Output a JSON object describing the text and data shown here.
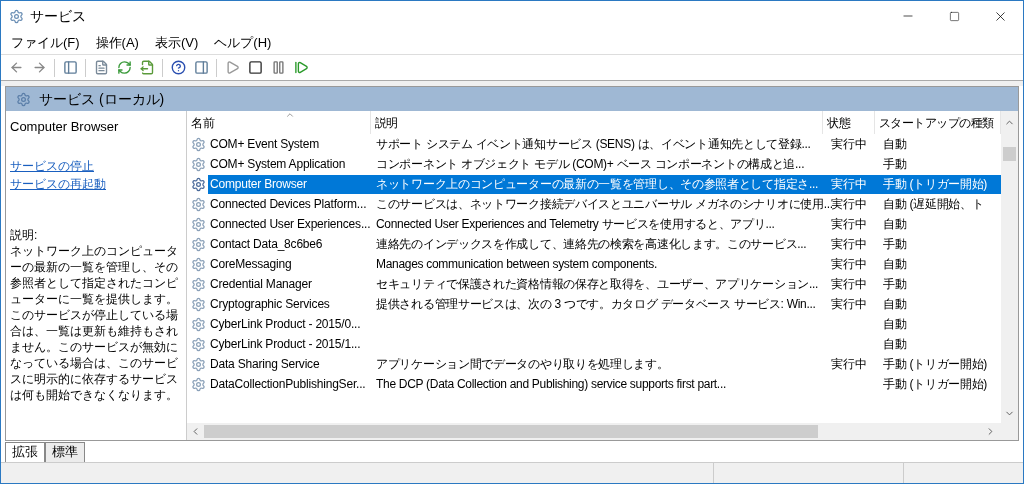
{
  "window": {
    "title": "サービス"
  },
  "menu": [
    "ファイル(F)",
    "操作(A)",
    "表示(V)",
    "ヘルプ(H)"
  ],
  "panel_header": "サービス (ローカル)",
  "detail": {
    "title": "Computer Browser",
    "links": [
      "サービスの停止",
      "サービスの再起動"
    ],
    "description_label": "説明:",
    "description": "ネットワーク上のコンピューターの最新の一覧を管理し、その参照者として指定されたコンピューターに一覧を提供します。このサービスが停止している場合は、一覧は更新も維持もされません。このサービスが無効になっている場合は、このサービスに明示的に依存するサービスは何も開始できなくなります。"
  },
  "table": {
    "columns": [
      "名前",
      "説明",
      "状態",
      "スタートアップの種類"
    ],
    "rows": [
      {
        "name": "COM+ Event System",
        "description": "サポート システム イベント通知サービス (SENS) は、イベント通知先として登録...",
        "status": "実行中",
        "startup": "自動",
        "selected": false
      },
      {
        "name": "COM+ System Application",
        "description": "コンポーネント オブジェクト モデル (COM)+ ベース コンポーネントの構成と追...",
        "status": "",
        "startup": "手動",
        "selected": false
      },
      {
        "name": "Computer Browser",
        "description": "ネットワーク上のコンピューターの最新の一覧を管理し、その参照者として指定さ...",
        "status": "実行中",
        "startup": "手動 (トリガー開始)",
        "selected": true
      },
      {
        "name": "Connected Devices Platform...",
        "description": "このサービスは、ネットワーク接続デバイスとユニバーサル メガネのシナリオに使用...",
        "status": "実行中",
        "startup": "自動 (遅延開始、ト",
        "selected": false
      },
      {
        "name": "Connected User Experiences...",
        "description": "Connected User Experiences and Telemetry サービスを使用すると、アプリ...",
        "status": "実行中",
        "startup": "自動",
        "selected": false
      },
      {
        "name": "Contact Data_8c6be6",
        "description": "連絡先のインデックスを作成して、連絡先の検索を高速化します。このサービス...",
        "status": "実行中",
        "startup": "手動",
        "selected": false
      },
      {
        "name": "CoreMessaging",
        "description": "Manages communication between system components.",
        "status": "実行中",
        "startup": "自動",
        "selected": false
      },
      {
        "name": "Credential Manager",
        "description": "セキュリティで保護された資格情報の保存と取得を、ユーザー、アプリケーション...",
        "status": "実行中",
        "startup": "手動",
        "selected": false
      },
      {
        "name": "Cryptographic Services",
        "description": "提供される管理サービスは、次の 3 つです。カタログ データベース サービス: Win...",
        "status": "実行中",
        "startup": "自動",
        "selected": false
      },
      {
        "name": "CyberLink Product - 2015/0...",
        "description": "",
        "status": "",
        "startup": "自動",
        "selected": false
      },
      {
        "name": "CyberLink Product - 2015/1...",
        "description": "",
        "status": "",
        "startup": "自動",
        "selected": false
      },
      {
        "name": "Data Sharing Service",
        "description": "アプリケーション間でデータのやり取りを処理します。",
        "status": "実行中",
        "startup": "手動 (トリガー開始)",
        "selected": false
      },
      {
        "name": "DataCollectionPublishingSer...",
        "description": "The DCP (Data Collection and Publishing) service supports first part...",
        "status": "",
        "startup": "手動 (トリガー開始)",
        "selected": false
      }
    ]
  },
  "tabs": [
    {
      "label": "拡張",
      "selected": true
    },
    {
      "label": "標準",
      "selected": false
    }
  ]
}
